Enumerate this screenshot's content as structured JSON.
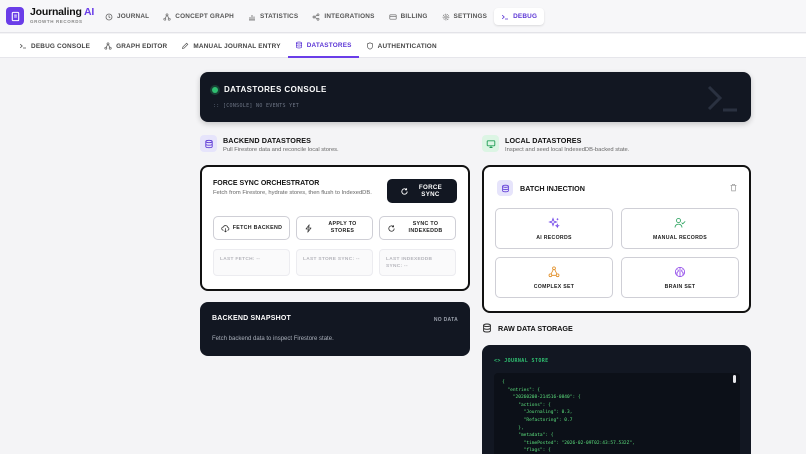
{
  "brand": {
    "name_main": "Journaling",
    "name_accent": "AI",
    "subtitle": "GROWTH RECORDS"
  },
  "nav": [
    {
      "label": "JOURNAL",
      "icon": "clock-icon"
    },
    {
      "label": "CONCEPT GRAPH",
      "icon": "graph-icon"
    },
    {
      "label": "STATISTICS",
      "icon": "bar-chart-icon"
    },
    {
      "label": "INTEGRATIONS",
      "icon": "share-icon"
    },
    {
      "label": "BILLING",
      "icon": "credit-card-icon"
    },
    {
      "label": "SETTINGS",
      "icon": "gear-icon"
    },
    {
      "label": "DEBUG",
      "icon": "terminal-icon",
      "active": true
    }
  ],
  "subnav": [
    {
      "label": "DEBUG CONSOLE",
      "icon": "terminal-icon"
    },
    {
      "label": "GRAPH EDITOR",
      "icon": "graph-icon"
    },
    {
      "label": "MANUAL JOURNAL ENTRY",
      "icon": "pen-icon"
    },
    {
      "label": "DATASTORES",
      "icon": "database-icon",
      "active": true
    },
    {
      "label": "AUTHENTICATION",
      "icon": "shield-icon"
    }
  ],
  "console": {
    "title": "DATASTORES CONSOLE",
    "log": ":: [CONSOLE] NO EVENTS YET"
  },
  "backend": {
    "title": "BACKEND DATASTORES",
    "description": "Pull Firestore data and reconcile local stores.",
    "orchestrator": {
      "title": "FORCE SYNC ORCHESTRATOR",
      "description": "Fetch from Firestore, hydrate stores, then flush to IndexedDB.",
      "force_label": "FORCE SYNC",
      "actions": [
        "FETCH BACKEND",
        "APPLY TO STORES",
        "SYNC TO INDEXEDDB"
      ],
      "stats": [
        "LAST FETCH: --",
        "LAST STORE SYNC: --",
        "LAST INDEXEDDB SYNC: --"
      ]
    },
    "snapshot": {
      "title": "BACKEND SNAPSHOT",
      "badge": "NO DATA",
      "description": "Fetch backend data to inspect Firestore state."
    }
  },
  "local": {
    "title": "LOCAL DATASTORES",
    "description": "Inspect and seed local IndexedDB-backed state.",
    "batch": {
      "title": "BATCH INJECTION",
      "tiles": [
        "AI RECORDS",
        "MANUAL RECORDS",
        "COMPLEX SET",
        "BRAIN SET"
      ]
    },
    "raw_title": "RAW DATA STORAGE",
    "store_header": "<> JOURNAL STORE",
    "json_text": "{\n  \"entries\": {\n    \"20260208-214516-0840\": {\n      \"actions\": {\n        \"Journaling\": 0.3,\n        \"Refactoring\": 0.7\n      },\n      \"metadata\": {\n        \"timePosted\": \"2026-02-09T02:43:57.532Z\",\n        \"flags\": {"
  },
  "colors": {
    "accent": "#6a3de8",
    "dark_panel": "#121722",
    "success": "#2fbf71"
  }
}
